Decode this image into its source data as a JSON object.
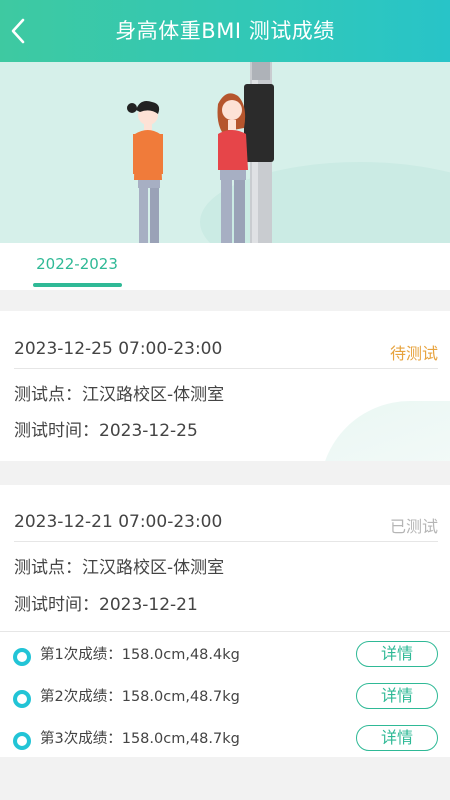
{
  "header": {
    "title": "身高体重BMI 测试成绩",
    "back_icon": "chevron-left-icon"
  },
  "tabs": [
    {
      "label": "2022-2023",
      "active": true
    }
  ],
  "records": [
    {
      "date": "2023-12-25 07:00-23:00",
      "status": "待测试",
      "status_color": "#e7a33e",
      "location": "测试点：江汉路校区-体测室",
      "test_time": "测试时间：2023-12-25"
    },
    {
      "date": "2023-12-21 07:00-23:00",
      "status": "已测试",
      "status_color": "#b5b5b5",
      "location": "测试点：江汉路校区-体测室",
      "test_time": "测试时间：2023-12-21",
      "results": [
        {
          "label": "第1次成绩：158.0cm,48.4kg",
          "button": "详情"
        },
        {
          "label": "第2次成绩：158.0cm,48.7kg",
          "button": "详情"
        },
        {
          "label": "第3次成绩：158.0cm,48.7kg",
          "button": "详情"
        }
      ]
    }
  ],
  "colors": {
    "accent": "#2fb996",
    "header_start": "#3ec9a1",
    "header_end": "#28c4c8",
    "ring": "#22c4d6"
  }
}
